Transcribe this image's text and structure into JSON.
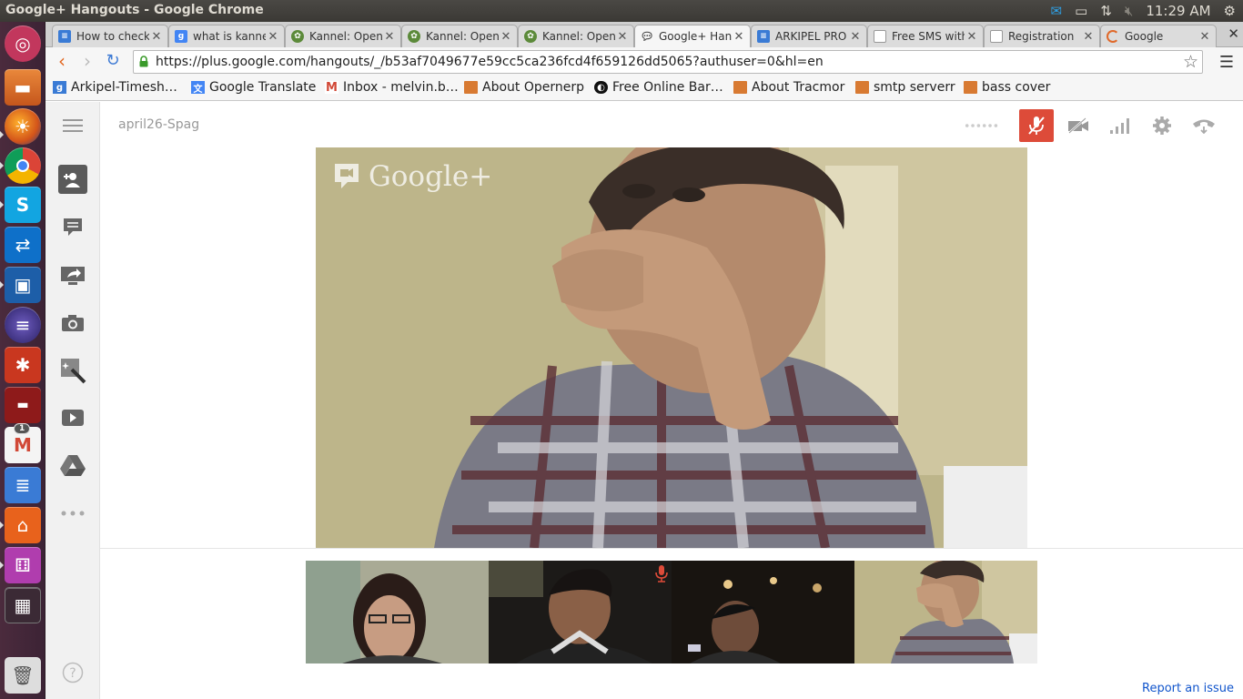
{
  "system": {
    "window_title": "Google+ Hangouts - Google Chrome",
    "clock": "11:29 AM",
    "launcher_badge": "1"
  },
  "browser": {
    "tabs": [
      {
        "label": "How to check",
        "icon": "google-docs-icon",
        "color": "#3a7bd5"
      },
      {
        "label": "what is kanne",
        "icon": "google-search-icon",
        "color": "#4285f4"
      },
      {
        "label": "Kannel: Open",
        "icon": "kannel-icon",
        "color": "#5c8a3a"
      },
      {
        "label": "Kannel: Open",
        "icon": "kannel-icon",
        "color": "#5c8a3a"
      },
      {
        "label": "Kannel: Open",
        "icon": "kannel-icon",
        "color": "#5c8a3a"
      },
      {
        "label": "Google+ Hang",
        "icon": "hangouts-icon",
        "color": "#555555",
        "active": true
      },
      {
        "label": "ARKIPEL PRO",
        "icon": "google-docs-icon",
        "color": "#3a7bd5"
      },
      {
        "label": "Free SMS with",
        "icon": "page-icon",
        "color": "#888888"
      },
      {
        "label": "Registration",
        "icon": "page-icon",
        "color": "#888888"
      },
      {
        "label": "Google",
        "icon": "loading-icon",
        "color": "#e0692a"
      }
    ],
    "url": "https://plus.google.com/hangouts/_/b53af7049677e59cc5ca236fcd4f659126dd5065?authuser=0&hl=en",
    "bookmarks": [
      {
        "label": "Arkipel-Timesh…",
        "icon": "google-docs-icon"
      },
      {
        "label": "Google Translate",
        "icon": "translate-icon"
      },
      {
        "label": "Inbox - melvin.b…",
        "icon": "gmail-icon"
      },
      {
        "label": "About Opernerp",
        "icon": "folder-icon"
      },
      {
        "label": "Free Online Bar…",
        "icon": "barcode-site-icon"
      },
      {
        "label": "About Tracmor",
        "icon": "folder-icon"
      },
      {
        "label": "smtp serverr",
        "icon": "folder-icon"
      },
      {
        "label": "bass cover",
        "icon": "folder-icon"
      }
    ]
  },
  "hangout": {
    "room_name": "april26-Spag",
    "watermark": "Google+",
    "report_link": "Report an issue",
    "mic_muted": true,
    "accent_color": "#dd4b39"
  }
}
